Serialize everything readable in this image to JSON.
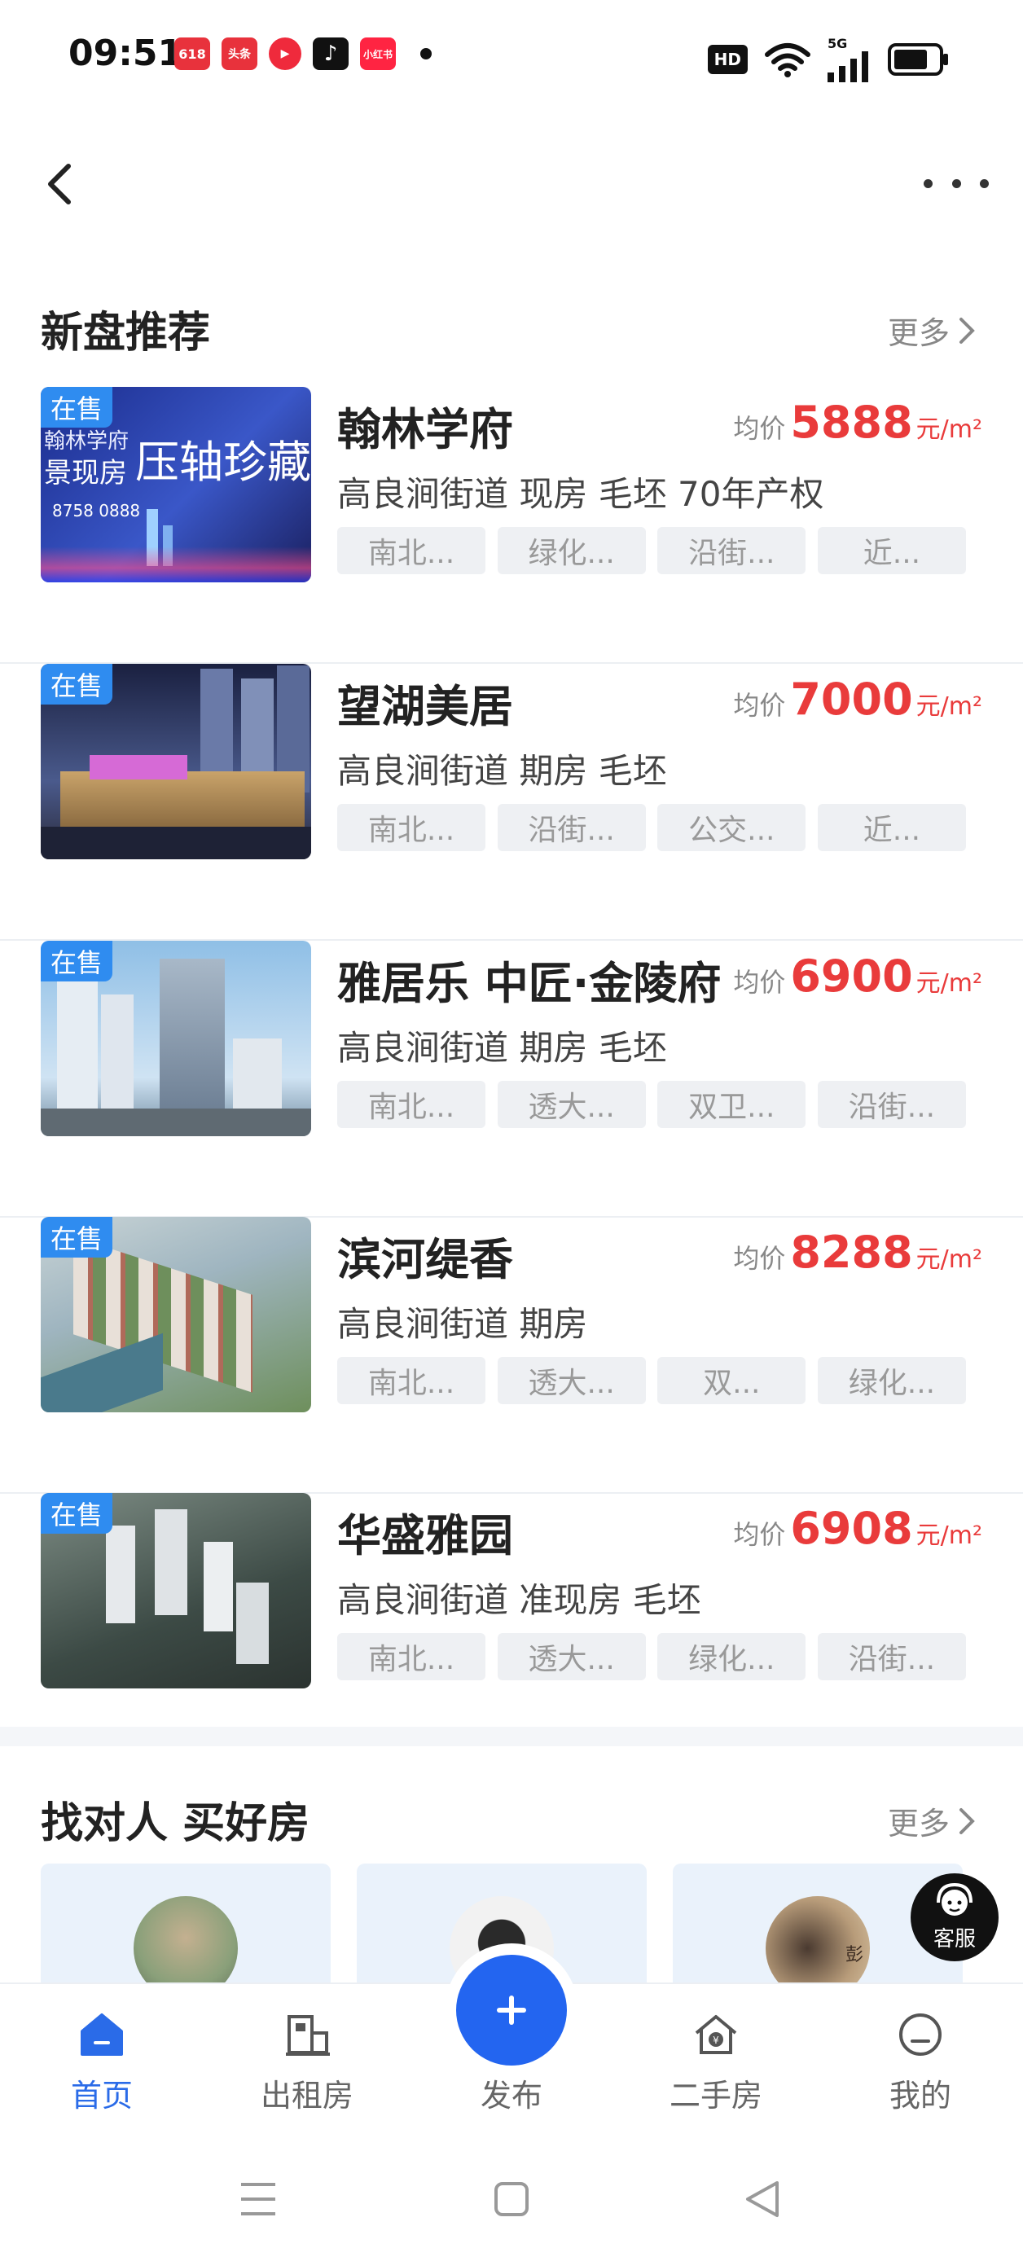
{
  "status_bar": {
    "time": "09:51",
    "apps": [
      {
        "icon": "app-618-icon",
        "text": "618",
        "color": "#e8323c"
      },
      {
        "icon": "toutiao-icon",
        "text": "头条",
        "color": "#e8323c"
      },
      {
        "icon": "video-play-icon",
        "text": "▶",
        "color": "#ef2a3c"
      },
      {
        "icon": "douyin-icon",
        "text": "♪",
        "color": "#111111"
      },
      {
        "icon": "xiaohongshu-icon",
        "text": "小红书",
        "color": "#ff2442"
      }
    ],
    "hd": "HD",
    "network": "5G"
  },
  "new_listings": {
    "title": "新盘推荐",
    "more": "更多",
    "items": [
      {
        "status": "在售",
        "name": "翰林学府",
        "price_label": "均价",
        "price": "5888",
        "unit": "元/m²",
        "desc": "高良涧街道 现房 毛坯 70年产权",
        "tags": [
          "南北...",
          "绿化...",
          "沿街...",
          "近..."
        ],
        "thumb_texts": [
          "翰林学府",
          "景现房",
          "压轴珍藏",
          "8758 0888"
        ],
        "img_colors": [
          "#1b2c8c",
          "#3a57c8",
          "#1a1f5e"
        ]
      },
      {
        "status": "在售",
        "name": "望湖美居",
        "price_label": "均价",
        "price": "7000",
        "unit": "元/m²",
        "desc": "高良涧街道 期房 毛坯",
        "tags": [
          "南北...",
          "沿街...",
          "公交...",
          "近..."
        ],
        "img_colors": [
          "#1a2040",
          "#4a5a8c",
          "#c9a36a"
        ]
      },
      {
        "status": "在售",
        "name": "雅居乐 中匠·金陵府",
        "price_label": "均价",
        "price": "6900",
        "unit": "元/m²",
        "desc": "高良涧街道 期房 毛坯",
        "tags": [
          "南北...",
          "透大...",
          "双卫...",
          "沿街..."
        ],
        "img_colors": [
          "#8fbfe6",
          "#cfe3f3",
          "#6f8aa0"
        ]
      },
      {
        "status": "在售",
        "name": "滨河缇香",
        "price_label": "均价",
        "price": "8288",
        "unit": "元/m²",
        "desc": "高良涧街道 期房",
        "tags": [
          "南北...",
          "透大...",
          "双...",
          "绿化..."
        ],
        "img_colors": [
          "#9fb5c0",
          "#6e8f5c",
          "#c9d4d6"
        ]
      },
      {
        "status": "在售",
        "name": "华盛雅园",
        "price_label": "均价",
        "price": "6908",
        "unit": "元/m²",
        "desc": "高良涧街道 准现房 毛坯",
        "tags": [
          "南北...",
          "透大...",
          "绿化...",
          "沿街..."
        ],
        "img_colors": [
          "#3c4a45",
          "#7d8c84",
          "#2b3330"
        ]
      }
    ]
  },
  "agents": {
    "title": "找对人 买好房",
    "more": "更多",
    "cards": [
      {
        "avatar": "agent-avatar-1",
        "color": "#8aa07a"
      },
      {
        "avatar": "agent-avatar-2",
        "color": "#f2f2f2"
      },
      {
        "avatar": "agent-avatar-3",
        "color": "#b89c7a"
      }
    ],
    "badge_text": "彭"
  },
  "customer_service": {
    "label": "客服"
  },
  "tab_bar": {
    "items": [
      {
        "label": "首页",
        "icon": "home-icon",
        "active": true
      },
      {
        "label": "出租房",
        "icon": "rent-house-icon",
        "active": false
      },
      {
        "label": "发布",
        "icon": "plus-icon",
        "active": false
      },
      {
        "label": "二手房",
        "icon": "second-hand-house-icon",
        "active": false
      },
      {
        "label": "我的",
        "icon": "profile-icon",
        "active": false
      }
    ]
  },
  "colors": {
    "accent": "#2365f0",
    "price": "#e93b3b",
    "sale_badge": "#2f8cf0"
  }
}
